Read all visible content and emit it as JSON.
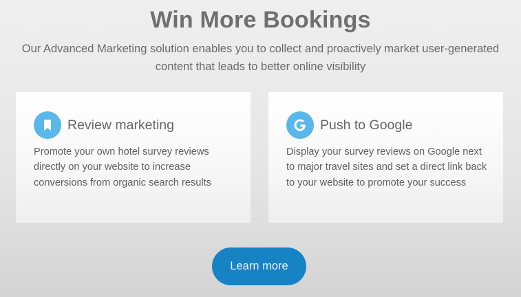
{
  "header": {
    "title": "Win More Bookings",
    "subtitle": "Our Advanced Marketing solution enables you to collect and proactively market user-generated content that leads to better online visibility"
  },
  "cards": [
    {
      "icon": "bookmark-icon",
      "title": "Review marketing",
      "text": "Promote your own hotel survey reviews directly on your website to increase conversions from organic search results"
    },
    {
      "icon": "google-icon",
      "title": "Push to Google",
      "text": "Display your survey reviews on Google next to major travel sites and set a direct link back to your website to promote your success"
    }
  ],
  "cta": {
    "label": "Learn more"
  },
  "colors": {
    "accent": "#1683c5",
    "icon_bg": "#5ab7ea"
  }
}
